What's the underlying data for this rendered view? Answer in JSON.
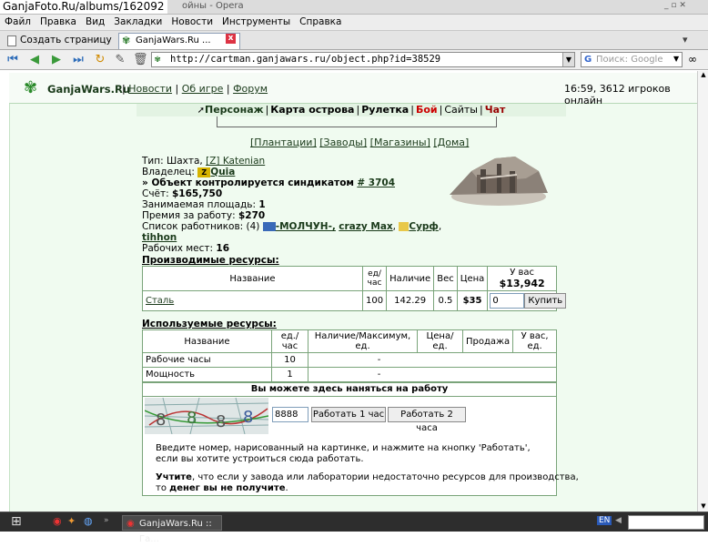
{
  "window": {
    "watermark": "GanjaFoto.Ru/albums/162092",
    "title": "ойны - Opera"
  },
  "menu": [
    "Файл",
    "Правка",
    "Вид",
    "Закладки",
    "Новости",
    "Инструменты",
    "Справка"
  ],
  "tabs": {
    "new_tab": "Создать страницу",
    "active": "GanjaWars.Ru ..."
  },
  "toolbar": {
    "url": "http://cartman.ganjawars.ru/object.php?id=38529",
    "search_placeholder": "Поиск: Google"
  },
  "site": {
    "logo": "GanjaWars.Ru",
    "links": [
      "Новости",
      "Об игре",
      "Форум"
    ],
    "status": "16:59, 3612 игроков онлайн",
    "nav": [
      "Персонаж",
      "Карта острова",
      "Рулетка",
      "Бой",
      "Сайты",
      "Чат"
    ],
    "sublinks": [
      "[Плантации]",
      "[Заводы]",
      "[Магазины]",
      "[Дома]"
    ]
  },
  "object": {
    "type_label": "Тип: Шахта,",
    "type_link": "[Z] Katenian",
    "owner_label": "Владелец:",
    "owner": "Quia",
    "syndicate_text": "» Объект контролируется синдикатом",
    "syndicate": "# 3704",
    "account_label": "Счёт:",
    "account": "$165,750",
    "area_label": "Занимаемая площадь:",
    "area": "1",
    "bonus_label": "Премия за работу:",
    "bonus": "$270",
    "workers_label": "Список работников: (4)",
    "workers": [
      "-МОЛЧУН-,",
      "crazy Max",
      ",",
      "Сурф",
      ",",
      "tihhon"
    ],
    "slots_label": "Рабочих мест:",
    "slots": "16"
  },
  "produced": {
    "title": "Производимые ресурсы:",
    "headers": [
      "Название",
      "ед/\nчас",
      "Наличие",
      "Вес",
      "Цена",
      "У вас"
    ],
    "you_have": "$13,942",
    "row": {
      "name": "Сталь",
      "rate": "100",
      "stock": "142.29",
      "weight": "0.5",
      "price": "$35",
      "qty": "0"
    },
    "buy_label": "Купить"
  },
  "used": {
    "title": "Используемые ресурсы:",
    "headers": [
      "Название",
      "ед./час",
      "Наличие/Максимум, ед.",
      "Цена/ед.",
      "Продажа",
      "У вас, ед."
    ],
    "rows": [
      {
        "name": "Рабочие часы",
        "rate": "10",
        "mid": "-"
      },
      {
        "name": "Мощность",
        "rate": "1",
        "mid": "-"
      }
    ]
  },
  "hire": {
    "title": "Вы можете здесь наняться на работу",
    "code": "8888",
    "work1": "Работать 1 час",
    "work2": "Работать 2 часа",
    "text1": "Введите номер, нарисованный на картинке, и нажмите на кнопку 'Работать',",
    "text2": "если вы хотите устроиться сюда работать.",
    "note_a": "Учтите",
    "note_b": ", что если у завода или лаборатории недостаточно ресурсов для производства,",
    "note_c": "то ",
    "note_d": "денег вы не получите",
    "note_e": "."
  },
  "taskbar": {
    "task": "GanjaWars.Ru :: Га...",
    "lang": "EN"
  },
  "colors": {
    "accent": "#1a3a1a",
    "nav_red": "#cc0000",
    "panel_bg": "#f0fbf0"
  }
}
